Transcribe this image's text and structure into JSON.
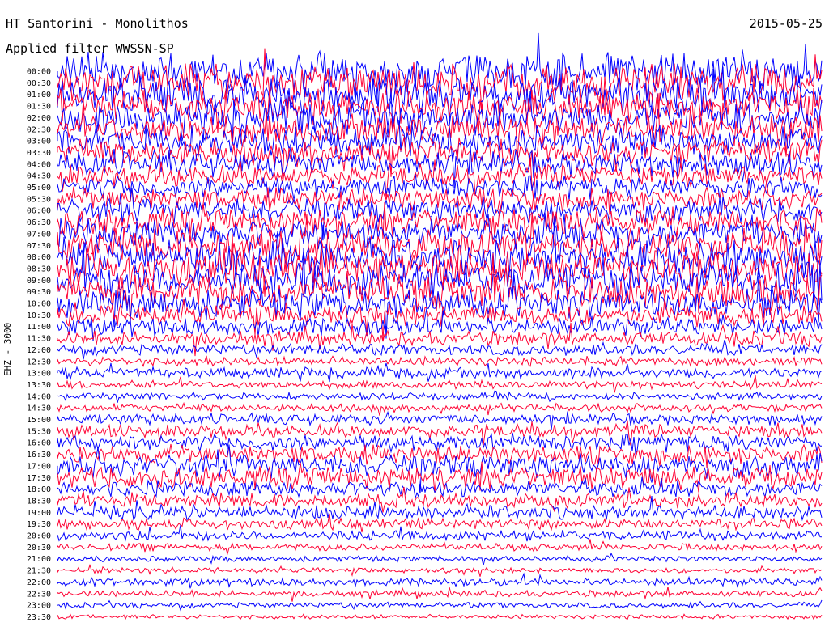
{
  "header": {
    "station": "HT Santorini - Monolithos",
    "date": "2015-05-25",
    "filter": "Applied filter WWSSN-SP"
  },
  "chart_data": {
    "type": "line",
    "title": "HT Santorini - Monolithos",
    "subtitle": "Applied filter WWSSN-SP",
    "ylabel": "EHZ - 3000",
    "date": "2015-05-25",
    "row_labels": [
      "00:00",
      "00:30",
      "01:00",
      "01:30",
      "02:00",
      "02:30",
      "03:00",
      "03:30",
      "04:00",
      "04:30",
      "05:00",
      "05:30",
      "06:00",
      "06:30",
      "07:00",
      "07:30",
      "08:00",
      "08:30",
      "09:00",
      "09:30",
      "10:00",
      "10:30",
      "11:00",
      "11:30",
      "12:00",
      "12:30",
      "13:00",
      "13:30",
      "14:00",
      "14:30",
      "15:00",
      "15:30",
      "16:00",
      "16:30",
      "17:00",
      "17:30",
      "18:00",
      "18:30",
      "19:00",
      "19:30",
      "20:00",
      "20:30",
      "21:00",
      "21:30",
      "22:00",
      "22:30",
      "23:00",
      "23:30"
    ],
    "series_colors": [
      "#0000ff",
      "#ff0033"
    ],
    "relative_amplitude": [
      1.0,
      1.0,
      0.95,
      0.9,
      0.9,
      0.85,
      0.8,
      0.75,
      0.7,
      0.6,
      0.6,
      0.6,
      0.7,
      0.75,
      0.8,
      0.9,
      1.0,
      1.0,
      1.0,
      0.95,
      0.8,
      0.6,
      0.5,
      0.4,
      0.3,
      0.25,
      0.3,
      0.22,
      0.2,
      0.22,
      0.3,
      0.35,
      0.45,
      0.5,
      0.65,
      0.6,
      0.45,
      0.4,
      0.4,
      0.3,
      0.28,
      0.2,
      0.15,
      0.15,
      0.22,
      0.18,
      0.15,
      0.12
    ]
  }
}
